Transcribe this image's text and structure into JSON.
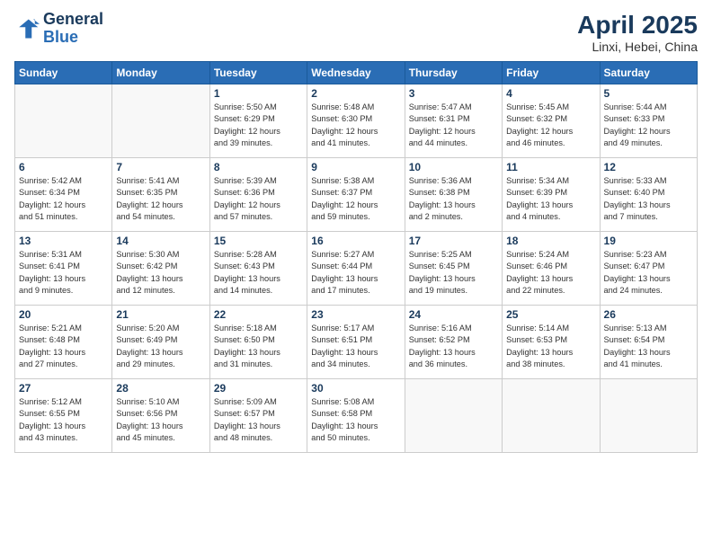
{
  "header": {
    "logo_line1": "General",
    "logo_line2": "Blue",
    "title": "April 2025",
    "subtitle": "Linxi, Hebei, China"
  },
  "weekdays": [
    "Sunday",
    "Monday",
    "Tuesday",
    "Wednesday",
    "Thursday",
    "Friday",
    "Saturday"
  ],
  "weeks": [
    [
      {
        "day": "",
        "info": ""
      },
      {
        "day": "",
        "info": ""
      },
      {
        "day": "1",
        "info": "Sunrise: 5:50 AM\nSunset: 6:29 PM\nDaylight: 12 hours\nand 39 minutes."
      },
      {
        "day": "2",
        "info": "Sunrise: 5:48 AM\nSunset: 6:30 PM\nDaylight: 12 hours\nand 41 minutes."
      },
      {
        "day": "3",
        "info": "Sunrise: 5:47 AM\nSunset: 6:31 PM\nDaylight: 12 hours\nand 44 minutes."
      },
      {
        "day": "4",
        "info": "Sunrise: 5:45 AM\nSunset: 6:32 PM\nDaylight: 12 hours\nand 46 minutes."
      },
      {
        "day": "5",
        "info": "Sunrise: 5:44 AM\nSunset: 6:33 PM\nDaylight: 12 hours\nand 49 minutes."
      }
    ],
    [
      {
        "day": "6",
        "info": "Sunrise: 5:42 AM\nSunset: 6:34 PM\nDaylight: 12 hours\nand 51 minutes."
      },
      {
        "day": "7",
        "info": "Sunrise: 5:41 AM\nSunset: 6:35 PM\nDaylight: 12 hours\nand 54 minutes."
      },
      {
        "day": "8",
        "info": "Sunrise: 5:39 AM\nSunset: 6:36 PM\nDaylight: 12 hours\nand 57 minutes."
      },
      {
        "day": "9",
        "info": "Sunrise: 5:38 AM\nSunset: 6:37 PM\nDaylight: 12 hours\nand 59 minutes."
      },
      {
        "day": "10",
        "info": "Sunrise: 5:36 AM\nSunset: 6:38 PM\nDaylight: 13 hours\nand 2 minutes."
      },
      {
        "day": "11",
        "info": "Sunrise: 5:34 AM\nSunset: 6:39 PM\nDaylight: 13 hours\nand 4 minutes."
      },
      {
        "day": "12",
        "info": "Sunrise: 5:33 AM\nSunset: 6:40 PM\nDaylight: 13 hours\nand 7 minutes."
      }
    ],
    [
      {
        "day": "13",
        "info": "Sunrise: 5:31 AM\nSunset: 6:41 PM\nDaylight: 13 hours\nand 9 minutes."
      },
      {
        "day": "14",
        "info": "Sunrise: 5:30 AM\nSunset: 6:42 PM\nDaylight: 13 hours\nand 12 minutes."
      },
      {
        "day": "15",
        "info": "Sunrise: 5:28 AM\nSunset: 6:43 PM\nDaylight: 13 hours\nand 14 minutes."
      },
      {
        "day": "16",
        "info": "Sunrise: 5:27 AM\nSunset: 6:44 PM\nDaylight: 13 hours\nand 17 minutes."
      },
      {
        "day": "17",
        "info": "Sunrise: 5:25 AM\nSunset: 6:45 PM\nDaylight: 13 hours\nand 19 minutes."
      },
      {
        "day": "18",
        "info": "Sunrise: 5:24 AM\nSunset: 6:46 PM\nDaylight: 13 hours\nand 22 minutes."
      },
      {
        "day": "19",
        "info": "Sunrise: 5:23 AM\nSunset: 6:47 PM\nDaylight: 13 hours\nand 24 minutes."
      }
    ],
    [
      {
        "day": "20",
        "info": "Sunrise: 5:21 AM\nSunset: 6:48 PM\nDaylight: 13 hours\nand 27 minutes."
      },
      {
        "day": "21",
        "info": "Sunrise: 5:20 AM\nSunset: 6:49 PM\nDaylight: 13 hours\nand 29 minutes."
      },
      {
        "day": "22",
        "info": "Sunrise: 5:18 AM\nSunset: 6:50 PM\nDaylight: 13 hours\nand 31 minutes."
      },
      {
        "day": "23",
        "info": "Sunrise: 5:17 AM\nSunset: 6:51 PM\nDaylight: 13 hours\nand 34 minutes."
      },
      {
        "day": "24",
        "info": "Sunrise: 5:16 AM\nSunset: 6:52 PM\nDaylight: 13 hours\nand 36 minutes."
      },
      {
        "day": "25",
        "info": "Sunrise: 5:14 AM\nSunset: 6:53 PM\nDaylight: 13 hours\nand 38 minutes."
      },
      {
        "day": "26",
        "info": "Sunrise: 5:13 AM\nSunset: 6:54 PM\nDaylight: 13 hours\nand 41 minutes."
      }
    ],
    [
      {
        "day": "27",
        "info": "Sunrise: 5:12 AM\nSunset: 6:55 PM\nDaylight: 13 hours\nand 43 minutes."
      },
      {
        "day": "28",
        "info": "Sunrise: 5:10 AM\nSunset: 6:56 PM\nDaylight: 13 hours\nand 45 minutes."
      },
      {
        "day": "29",
        "info": "Sunrise: 5:09 AM\nSunset: 6:57 PM\nDaylight: 13 hours\nand 48 minutes."
      },
      {
        "day": "30",
        "info": "Sunrise: 5:08 AM\nSunset: 6:58 PM\nDaylight: 13 hours\nand 50 minutes."
      },
      {
        "day": "",
        "info": ""
      },
      {
        "day": "",
        "info": ""
      },
      {
        "day": "",
        "info": ""
      }
    ]
  ]
}
